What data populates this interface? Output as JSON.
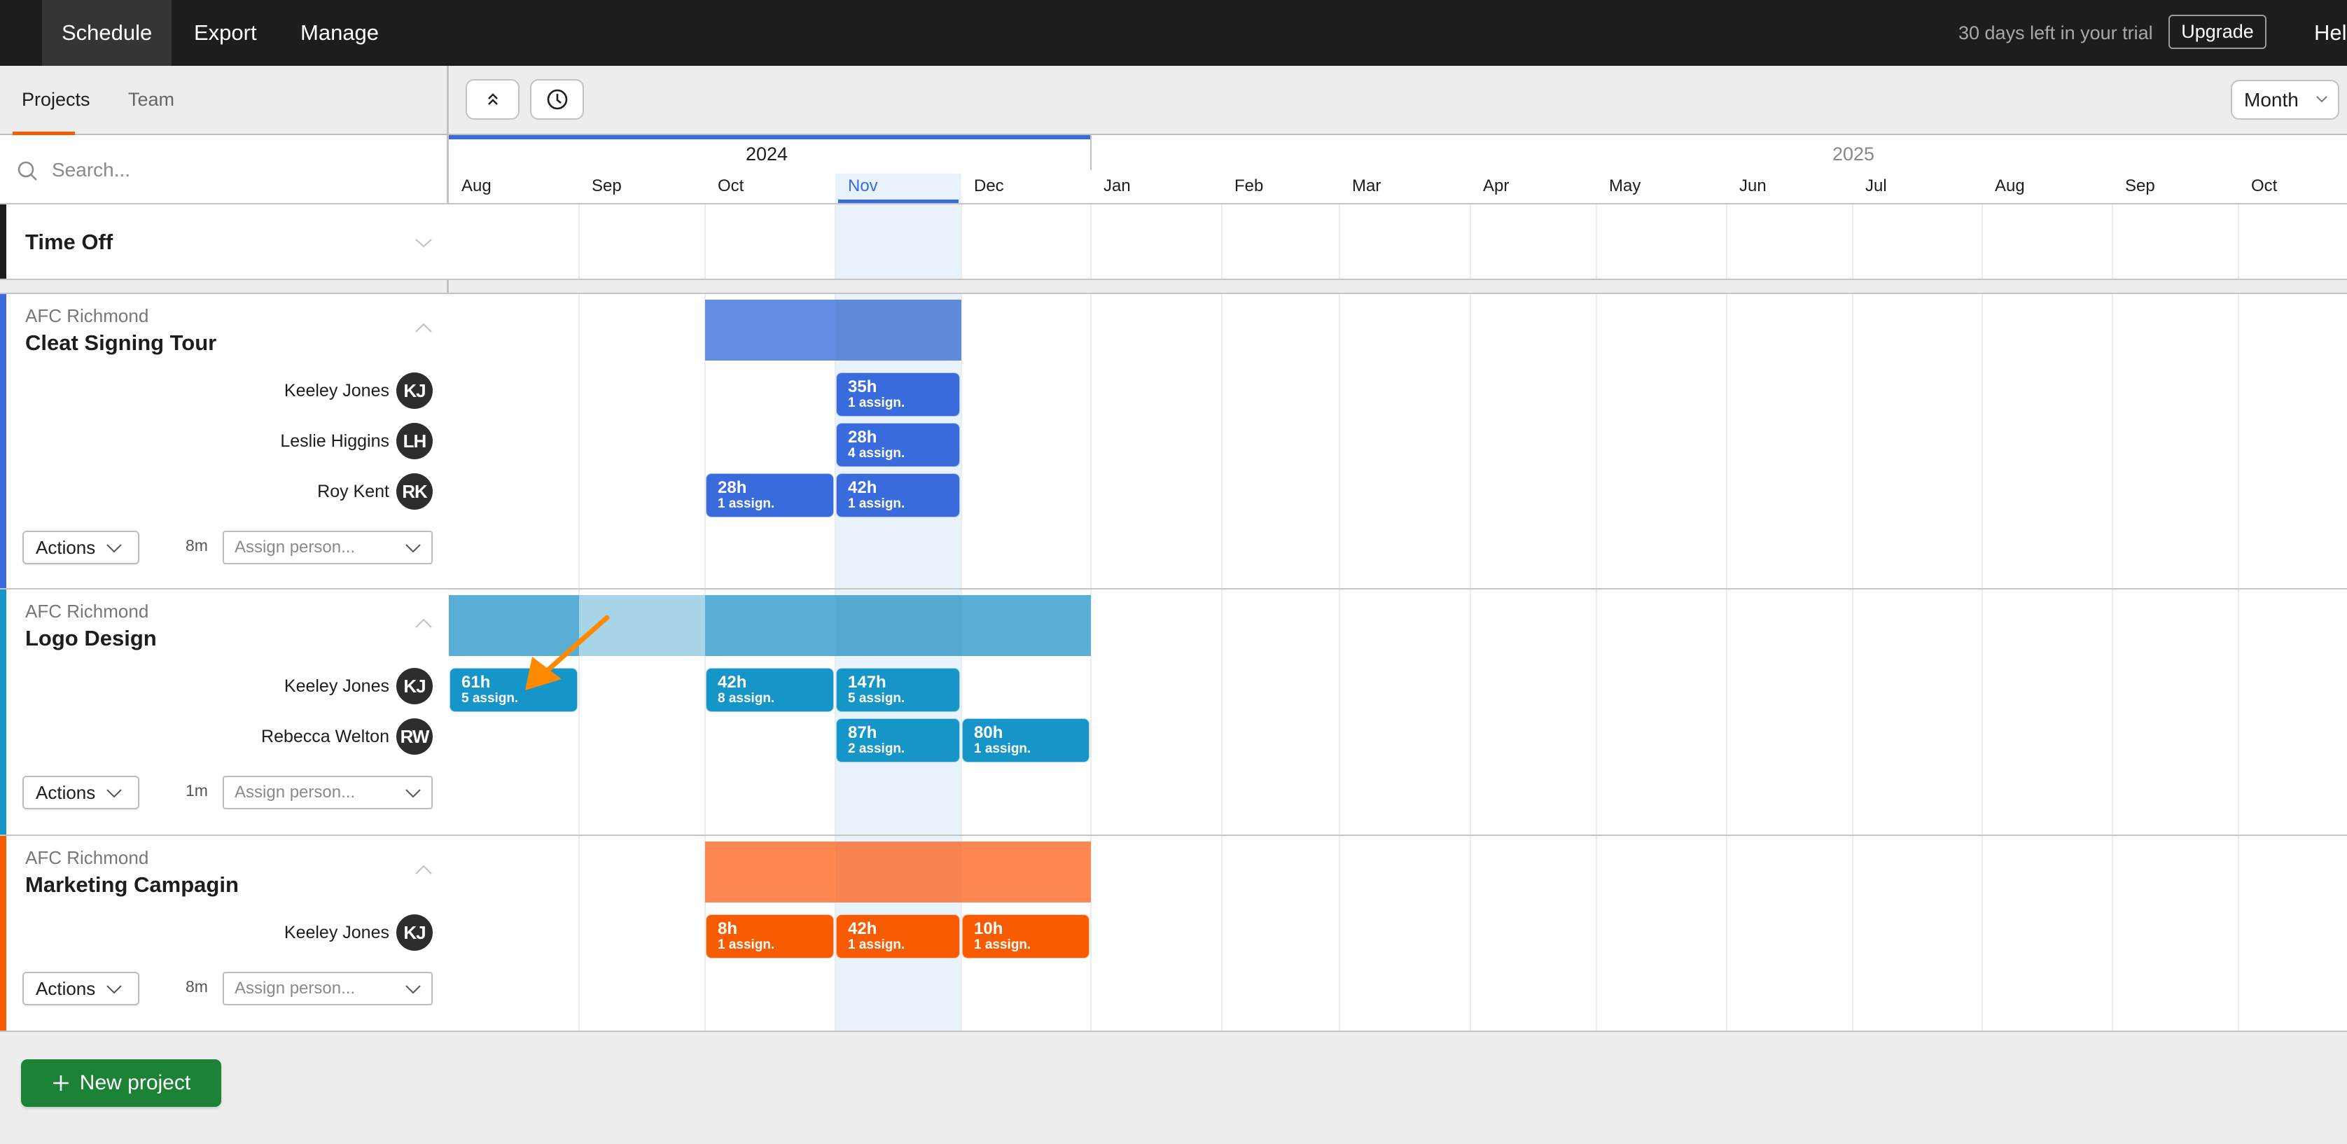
{
  "topbar": {
    "nav": [
      {
        "label": "Schedule",
        "active": true
      },
      {
        "label": "Export",
        "active": false
      },
      {
        "label": "Manage",
        "active": false
      }
    ],
    "trial_text": "30 days left in your trial",
    "upgrade_label": "Upgrade",
    "help_label": "Help"
  },
  "left_panel": {
    "tabs": [
      {
        "label": "Projects",
        "active": true
      },
      {
        "label": "Team",
        "active": false
      }
    ],
    "search_placeholder": "Search..."
  },
  "toolbar": {
    "collapse_icon": "chevrons-up-icon",
    "time_icon": "clock-icon",
    "view_select": "Month"
  },
  "timeline": {
    "years": [
      {
        "label": "2024",
        "current": true
      },
      {
        "label": "2025",
        "current": false
      }
    ],
    "months": [
      {
        "label": "Aug",
        "year": "2024"
      },
      {
        "label": "Sep",
        "year": "2024"
      },
      {
        "label": "Oct",
        "year": "2024"
      },
      {
        "label": "Nov",
        "year": "2024",
        "current": true
      },
      {
        "label": "Dec",
        "year": "2024"
      },
      {
        "label": "Jan",
        "year": "2025"
      },
      {
        "label": "Feb",
        "year": "2025"
      },
      {
        "label": "Mar",
        "year": "2025"
      },
      {
        "label": "Apr",
        "year": "2025"
      },
      {
        "label": "May",
        "year": "2025"
      },
      {
        "label": "Jun",
        "year": "2025"
      },
      {
        "label": "Jul",
        "year": "2025"
      },
      {
        "label": "Aug",
        "year": "2025"
      },
      {
        "label": "Sep",
        "year": "2025"
      },
      {
        "label": "Oct",
        "year": "2025"
      }
    ]
  },
  "time_off": {
    "title": "Time Off",
    "color": "#1d1d1b"
  },
  "projects": [
    {
      "client": "AFC Richmond",
      "title": "Cleat Signing Tour",
      "color": "#3a6bdc",
      "bar_color": "#648ee4",
      "duration": "8m",
      "actions_label": "Actions",
      "assign_placeholder": "Assign person...",
      "project_span": [
        "Oct",
        "Nov"
      ],
      "people": [
        {
          "name": "Keeley Jones",
          "initials": "KJ",
          "allocations": [
            {
              "month": "Nov",
              "hours": "35h",
              "assignments": "1 assign."
            }
          ]
        },
        {
          "name": "Leslie Higgins",
          "initials": "LH",
          "allocations": [
            {
              "month": "Nov",
              "hours": "28h",
              "assignments": "4 assign."
            }
          ]
        },
        {
          "name": "Roy Kent",
          "initials": "RK",
          "allocations": [
            {
              "month": "Oct",
              "hours": "28h",
              "assignments": "1 assign."
            },
            {
              "month": "Nov",
              "hours": "42h",
              "assignments": "1 assign."
            }
          ]
        }
      ]
    },
    {
      "client": "AFC Richmond",
      "title": "Logo Design",
      "color": "#1695c9",
      "bar_color": "#5aaed5",
      "bar_light_color": "#a8d4e8",
      "duration": "1m",
      "actions_label": "Actions",
      "assign_placeholder": "Assign person...",
      "project_span": [
        "Aug",
        "Dec"
      ],
      "gap_months": [
        "Sep"
      ],
      "people": [
        {
          "name": "Keeley Jones",
          "initials": "KJ",
          "allocations": [
            {
              "month": "Aug",
              "hours": "61h",
              "assignments": "5 assign."
            },
            {
              "month": "Oct",
              "hours": "42h",
              "assignments": "8 assign."
            },
            {
              "month": "Nov",
              "hours": "147h",
              "assignments": "5 assign."
            }
          ]
        },
        {
          "name": "Rebecca Welton",
          "initials": "RW",
          "allocations": [
            {
              "month": "Nov",
              "hours": "87h",
              "assignments": "2 assign."
            },
            {
              "month": "Dec",
              "hours": "80h",
              "assignments": "1 assign."
            }
          ]
        }
      ]
    },
    {
      "client": "AFC Richmond",
      "title": "Marketing Campagin",
      "color": "#f85c02",
      "bar_color": "#ff8752",
      "duration": "8m",
      "actions_label": "Actions",
      "assign_placeholder": "Assign person...",
      "project_span": [
        "Oct",
        "Dec"
      ],
      "people": [
        {
          "name": "Keeley Jones",
          "initials": "KJ",
          "allocations": [
            {
              "month": "Oct",
              "hours": "8h",
              "assignments": "1 assign."
            },
            {
              "month": "Nov",
              "hours": "42h",
              "assignments": "1 assign."
            },
            {
              "month": "Dec",
              "hours": "10h",
              "assignments": "1 assign."
            }
          ]
        }
      ]
    }
  ],
  "footer": {
    "new_project_label": "New project"
  },
  "annotation": {
    "type": "arrow",
    "color": "#ff8a00"
  }
}
